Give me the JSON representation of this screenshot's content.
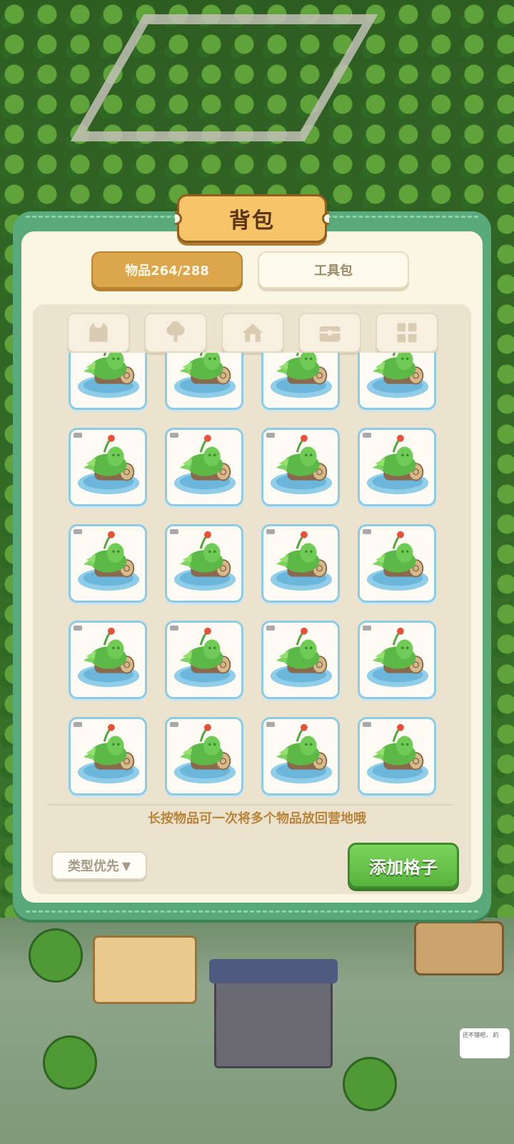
{
  "world": {
    "chat_text": "还不错吧，\n的"
  },
  "backpack": {
    "title": "背包",
    "tabs": [
      {
        "label": "物品264/288",
        "active": true
      },
      {
        "label": "工具包",
        "active": false
      }
    ],
    "filters": [
      {
        "icon": "cat-icon"
      },
      {
        "icon": "tree-icon"
      },
      {
        "icon": "house-icon"
      },
      {
        "icon": "chest-icon"
      },
      {
        "icon": "grid-icon"
      }
    ],
    "items": {
      "item_icon": "mossy-log-pond-icon",
      "rows": 5,
      "columns": 4,
      "first_row_partially_scrolled": true
    },
    "hint": "长按物品可一次将多个物品放回营地哦",
    "sort_label": "类型优先",
    "add_slots_label": "添加格子"
  },
  "colors": {
    "panel_green": "#5aa97a",
    "panel_cream": "#fbf5e4",
    "active_tab": "#dba64c",
    "add_button": "#58b33e",
    "item_border": "#8ccbe3"
  }
}
